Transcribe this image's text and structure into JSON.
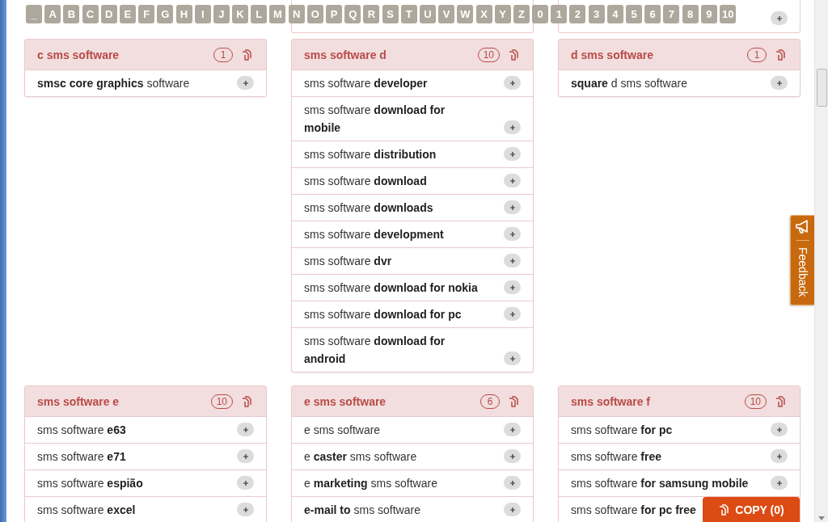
{
  "letter_bar": [
    "_",
    "A",
    "B",
    "C",
    "D",
    "E",
    "F",
    "G",
    "H",
    "I",
    "J",
    "K",
    "L",
    "M",
    "N",
    "O",
    "P",
    "Q",
    "R",
    "S",
    "T",
    "U",
    "V",
    "W",
    "X",
    "Y",
    "Z",
    "0",
    "1",
    "2",
    "3",
    "4",
    "5",
    "6",
    "7",
    "8",
    "9",
    "10"
  ],
  "card_groups": [
    {
      "title": "c sms software",
      "count": "1",
      "items": [
        "**smsc core graphics** software"
      ]
    },
    {
      "title": "sms software d",
      "count": "10",
      "items": [
        "sms software **developer**",
        "sms software **download for mobile**",
        "sms software **distribution**",
        "sms software **download**",
        "sms software **downloads**",
        "sms software **development**",
        "sms software **dvr**",
        "sms software **download for nokia**",
        "sms software **download for pc**",
        "sms software **download for android**"
      ]
    },
    {
      "title": "d sms software",
      "count": "1",
      "items": [
        "**square** d sms software"
      ]
    },
    {
      "title": "sms software e",
      "count": "10",
      "items": [
        "sms software **e63**",
        "sms software **e71**",
        "sms software **espião**",
        "sms software **excel**"
      ]
    },
    {
      "title": "e sms software",
      "count": "6",
      "items": [
        "e sms software",
        "e **caster** sms software",
        "e **marketing** sms software",
        "**e-mail to** sms software"
      ]
    },
    {
      "title": "sms software f",
      "count": "10",
      "items": [
        "sms software **for pc**",
        "sms software **free**",
        "sms software **for samsung mobile**",
        "sms software **for pc free**"
      ]
    }
  ],
  "feedback_tab": {
    "label": "Feedback"
  },
  "copy_button": {
    "label": "COPY (0)"
  }
}
